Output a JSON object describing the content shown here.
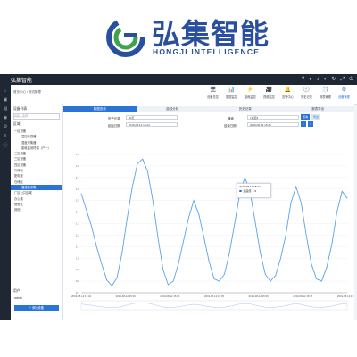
{
  "brand": {
    "name_cn": "弘集智能",
    "name_en": "HONGJI INTELLIGENCE",
    "app_title": "弘集智能",
    "color": "#2a4f9e"
  },
  "topbar_icons": [
    "help-icon",
    "user-icon",
    "bell-icon",
    "sound-icon",
    "refresh-icon",
    "fullscreen-icon",
    "power-icon"
  ],
  "breadcrumb": "首页中心 / 物流管理",
  "modules": [
    {
      "label": "设备总控",
      "icon": "🖥"
    },
    {
      "label": "数据监控",
      "icon": "📊"
    },
    {
      "label": "能耗监控",
      "icon": "⚡"
    },
    {
      "label": "视频监控",
      "icon": "🎥"
    },
    {
      "label": "告警中心",
      "icon": "🔔"
    },
    {
      "label": "历史记录",
      "icon": "🕘"
    },
    {
      "label": "报表管理",
      "icon": "📑"
    },
    {
      "label": "设备管理",
      "icon": "⚙"
    }
  ],
  "sidebar": {
    "header": "设备列表",
    "search_placeholder": "请输入名称",
    "section": "区域",
    "items": [
      {
        "label": "一区设备",
        "sub": false,
        "selected": false
      },
      {
        "label": "温控传感器1",
        "sub": true,
        "selected": false
      },
      {
        "label": "湿度采集器",
        "sub": true,
        "selected": false
      },
      {
        "label": "能耗监测终端（户一）",
        "sub": true,
        "selected": false
      },
      {
        "label": "二区设备",
        "sub": false,
        "selected": false
      },
      {
        "label": "三区设备",
        "sub": false,
        "selected": false
      },
      {
        "label": "四区设备",
        "sub": false,
        "selected": false
      },
      {
        "label": "冷库区",
        "sub": false,
        "selected": false
      },
      {
        "label": "配电室",
        "sub": false,
        "selected": false
      },
      {
        "label": "仓储区",
        "sub": false,
        "selected": false
      },
      {
        "label": "温湿度采集",
        "sub": true,
        "selected": true
      },
      {
        "label": "厂区公共区域",
        "sub": false,
        "selected": false
      },
      {
        "label": "办公楼",
        "sub": false,
        "selected": false
      },
      {
        "label": "宿舍区",
        "sub": false,
        "selected": false
      },
      {
        "label": "其他",
        "sub": false,
        "selected": false
      }
    ],
    "footer_label": "用户",
    "footer_value": "admin",
    "add_button": "+ 添加设备"
  },
  "content": {
    "tabs": [
      "数据查询",
      "曲线分析",
      "历史记录",
      "报表导出"
    ],
    "active_tab": 0,
    "form": {
      "history_label": "历史记录",
      "history_value": "30天",
      "start_label": "起始日期",
      "start_value": "2019-08-12 15:24",
      "channel_label": "通道",
      "channel_value": "1通道▾",
      "end_label": "结束日期",
      "end_value": "2019-08-12 15:24",
      "query_btn": "查询",
      "export_btn": "导出"
    },
    "tooltip": {
      "date": "2019-08-12 15:24",
      "series": "温度值",
      "value": "1.5"
    }
  },
  "chart_data": {
    "type": "line",
    "title": "",
    "xlabel": "",
    "ylabel": "",
    "ylim": [
      0.7,
      1.9
    ],
    "y_ticks": [
      "1.9",
      "1.8",
      "1.7",
      "1.6",
      "1.5",
      "1.4",
      "1.3",
      "1.2",
      "1.1",
      "1.0",
      "0.9",
      "0.8",
      "0.7"
    ],
    "x_tick_labels": [
      "2019-08-12 15:34",
      "2019-08-12 15:33",
      "2019-08-12 15:34",
      "2019-08-12 15:35",
      "2019-08-12 15:36",
      "2019-08-12 15:37",
      "2019-08-12 15:38"
    ],
    "series": [
      {
        "name": "温度值",
        "values": [
          1.56,
          1.42,
          1.28,
          1.1,
          0.95,
          0.81,
          0.76,
          0.83,
          1.05,
          1.35,
          1.62,
          1.82,
          1.86,
          1.75,
          1.5,
          1.18,
          0.9,
          0.77,
          0.8,
          0.95,
          1.15,
          1.35,
          1.5,
          1.38,
          1.18,
          0.97,
          0.82,
          0.8,
          0.86,
          1.05,
          1.3,
          1.56,
          1.7,
          1.58,
          1.32,
          1.05,
          0.86,
          0.8,
          0.85,
          1.0,
          1.2,
          1.48,
          1.62,
          1.48,
          1.2,
          0.95,
          0.82,
          0.8,
          0.92,
          1.12,
          1.4,
          1.58,
          1.52
        ]
      }
    ],
    "grid": true,
    "color": "#5aa2e6"
  }
}
